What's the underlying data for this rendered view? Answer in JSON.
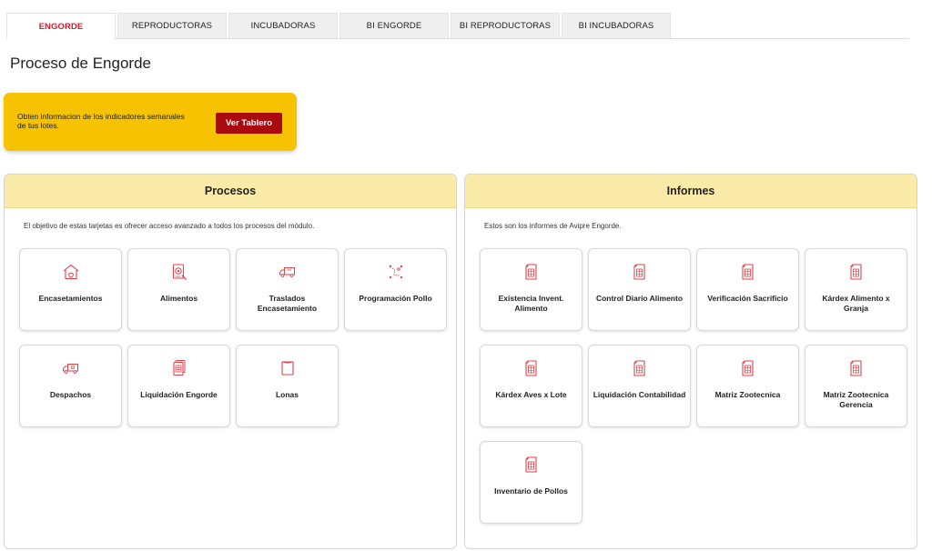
{
  "tabs": [
    {
      "label": "ENGORDE",
      "active": true
    },
    {
      "label": "REPRODUCTORAS",
      "active": false
    },
    {
      "label": "INCUBADORAS",
      "active": false
    },
    {
      "label": "BI ENGORDE",
      "active": false
    },
    {
      "label": "BI REPRODUCTORAS",
      "active": false
    },
    {
      "label": "BI INCUBADORAS",
      "active": false
    }
  ],
  "page_title": "Proceso de Engorde",
  "promo": {
    "text": "Obten informacion de los indicadores semanales de tus lotes.",
    "button_label": "Ver Tablero"
  },
  "procesos": {
    "title": "Procesos",
    "description": "El objetivo de estas tarjetas es ofrecer acceso avanzado a todos los procesos del módulo.",
    "cards": [
      {
        "label": "Encasetamientos",
        "icon": "house-icon"
      },
      {
        "label": "Alimentos",
        "icon": "feed-icon"
      },
      {
        "label": "Traslados Encasetamiento",
        "icon": "truck-icon"
      },
      {
        "label": "Programación Pollo",
        "icon": "schedule-icon"
      },
      {
        "label": "Despachos",
        "icon": "truck-icon"
      },
      {
        "label": "Liquidación Engorde",
        "icon": "document-icon"
      },
      {
        "label": "Lonas",
        "icon": "tarp-icon"
      }
    ]
  },
  "informes": {
    "title": "Informes",
    "description": "Estos son los informes de Avipre Engorde.",
    "cards": [
      {
        "label": "Existencia Invent. Alimento",
        "icon": "report-icon"
      },
      {
        "label": "Control Diario Alimento",
        "icon": "report-icon"
      },
      {
        "label": "Verificación Sacrificio",
        "icon": "report-icon"
      },
      {
        "label": "Kárdex Alimento x Granja",
        "icon": "report-icon"
      },
      {
        "label": "Kárdex Aves x Lote",
        "icon": "report-icon"
      },
      {
        "label": "Liquidación Contabilidad",
        "icon": "report-icon"
      },
      {
        "label": "Matriz Zootecnica",
        "icon": "report-icon"
      },
      {
        "label": "Matriz Zootecnica Gerencia",
        "icon": "report-icon"
      },
      {
        "label": "Inventario de Pollos",
        "icon": "report-icon"
      }
    ]
  },
  "colors": {
    "accent_red": "#d0202a",
    "button_red": "#a80a0f",
    "promo_yellow": "#f7c200",
    "panel_header": "#fbeba8",
    "icon_red": "#e0424a"
  }
}
